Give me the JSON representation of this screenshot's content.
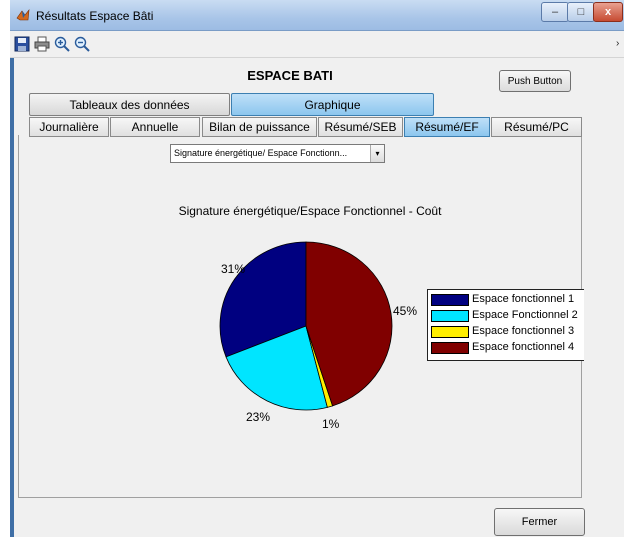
{
  "window": {
    "title": "Résultats Espace Bâti",
    "min_glyph": "–",
    "max_glyph": "□",
    "close_glyph": "x",
    "overflow_glyph": "›"
  },
  "toolbar": {
    "icons": [
      "save-icon",
      "print-icon",
      "zoom-in-icon",
      "zoom-out-icon"
    ]
  },
  "header": {
    "title": "ESPACE BATI",
    "push_button": "Push Button"
  },
  "main_tabs": [
    {
      "label": "Tableaux des données",
      "active": false
    },
    {
      "label": "Graphique",
      "active": true
    }
  ],
  "sub_tabs": [
    {
      "label": "Journalière",
      "active": false
    },
    {
      "label": "Annuelle",
      "active": false
    },
    {
      "label": "Bilan de puissance",
      "active": false
    },
    {
      "label": "Résumé/SEB",
      "active": false
    },
    {
      "label": "Résumé/EF",
      "active": true
    },
    {
      "label": "Résumé/PC",
      "active": false
    }
  ],
  "dropdown": {
    "selected": "Signature énergétique/ Espace Fonctionn...",
    "arrow_glyph": "▾"
  },
  "chart_data": {
    "type": "pie",
    "title": "Signature énergétique/Espace Fonctionnel - Coût",
    "slices": [
      {
        "label": "Espace fonctionnel 1",
        "pct_label": "31%",
        "value": 31,
        "color": "#000080"
      },
      {
        "label": "Espace Fonctionnel 2",
        "pct_label": "23%",
        "value": 23,
        "color": "#00e5ff"
      },
      {
        "label": "Espace fonctionnel 3",
        "pct_label": "1%",
        "value": 1,
        "color": "#ffee00"
      },
      {
        "label": "Espace fonctionnel 4",
        "pct_label": "45%",
        "value": 45,
        "color": "#800000"
      }
    ],
    "legend": {
      "placement": "right",
      "entries": [
        "Espace fonctionnel 1",
        "Espace Fonctionnel 2",
        "Espace fonctionnel 3",
        "Espace fonctionnel 4"
      ]
    }
  },
  "footer": {
    "close_button": "Fermer"
  }
}
